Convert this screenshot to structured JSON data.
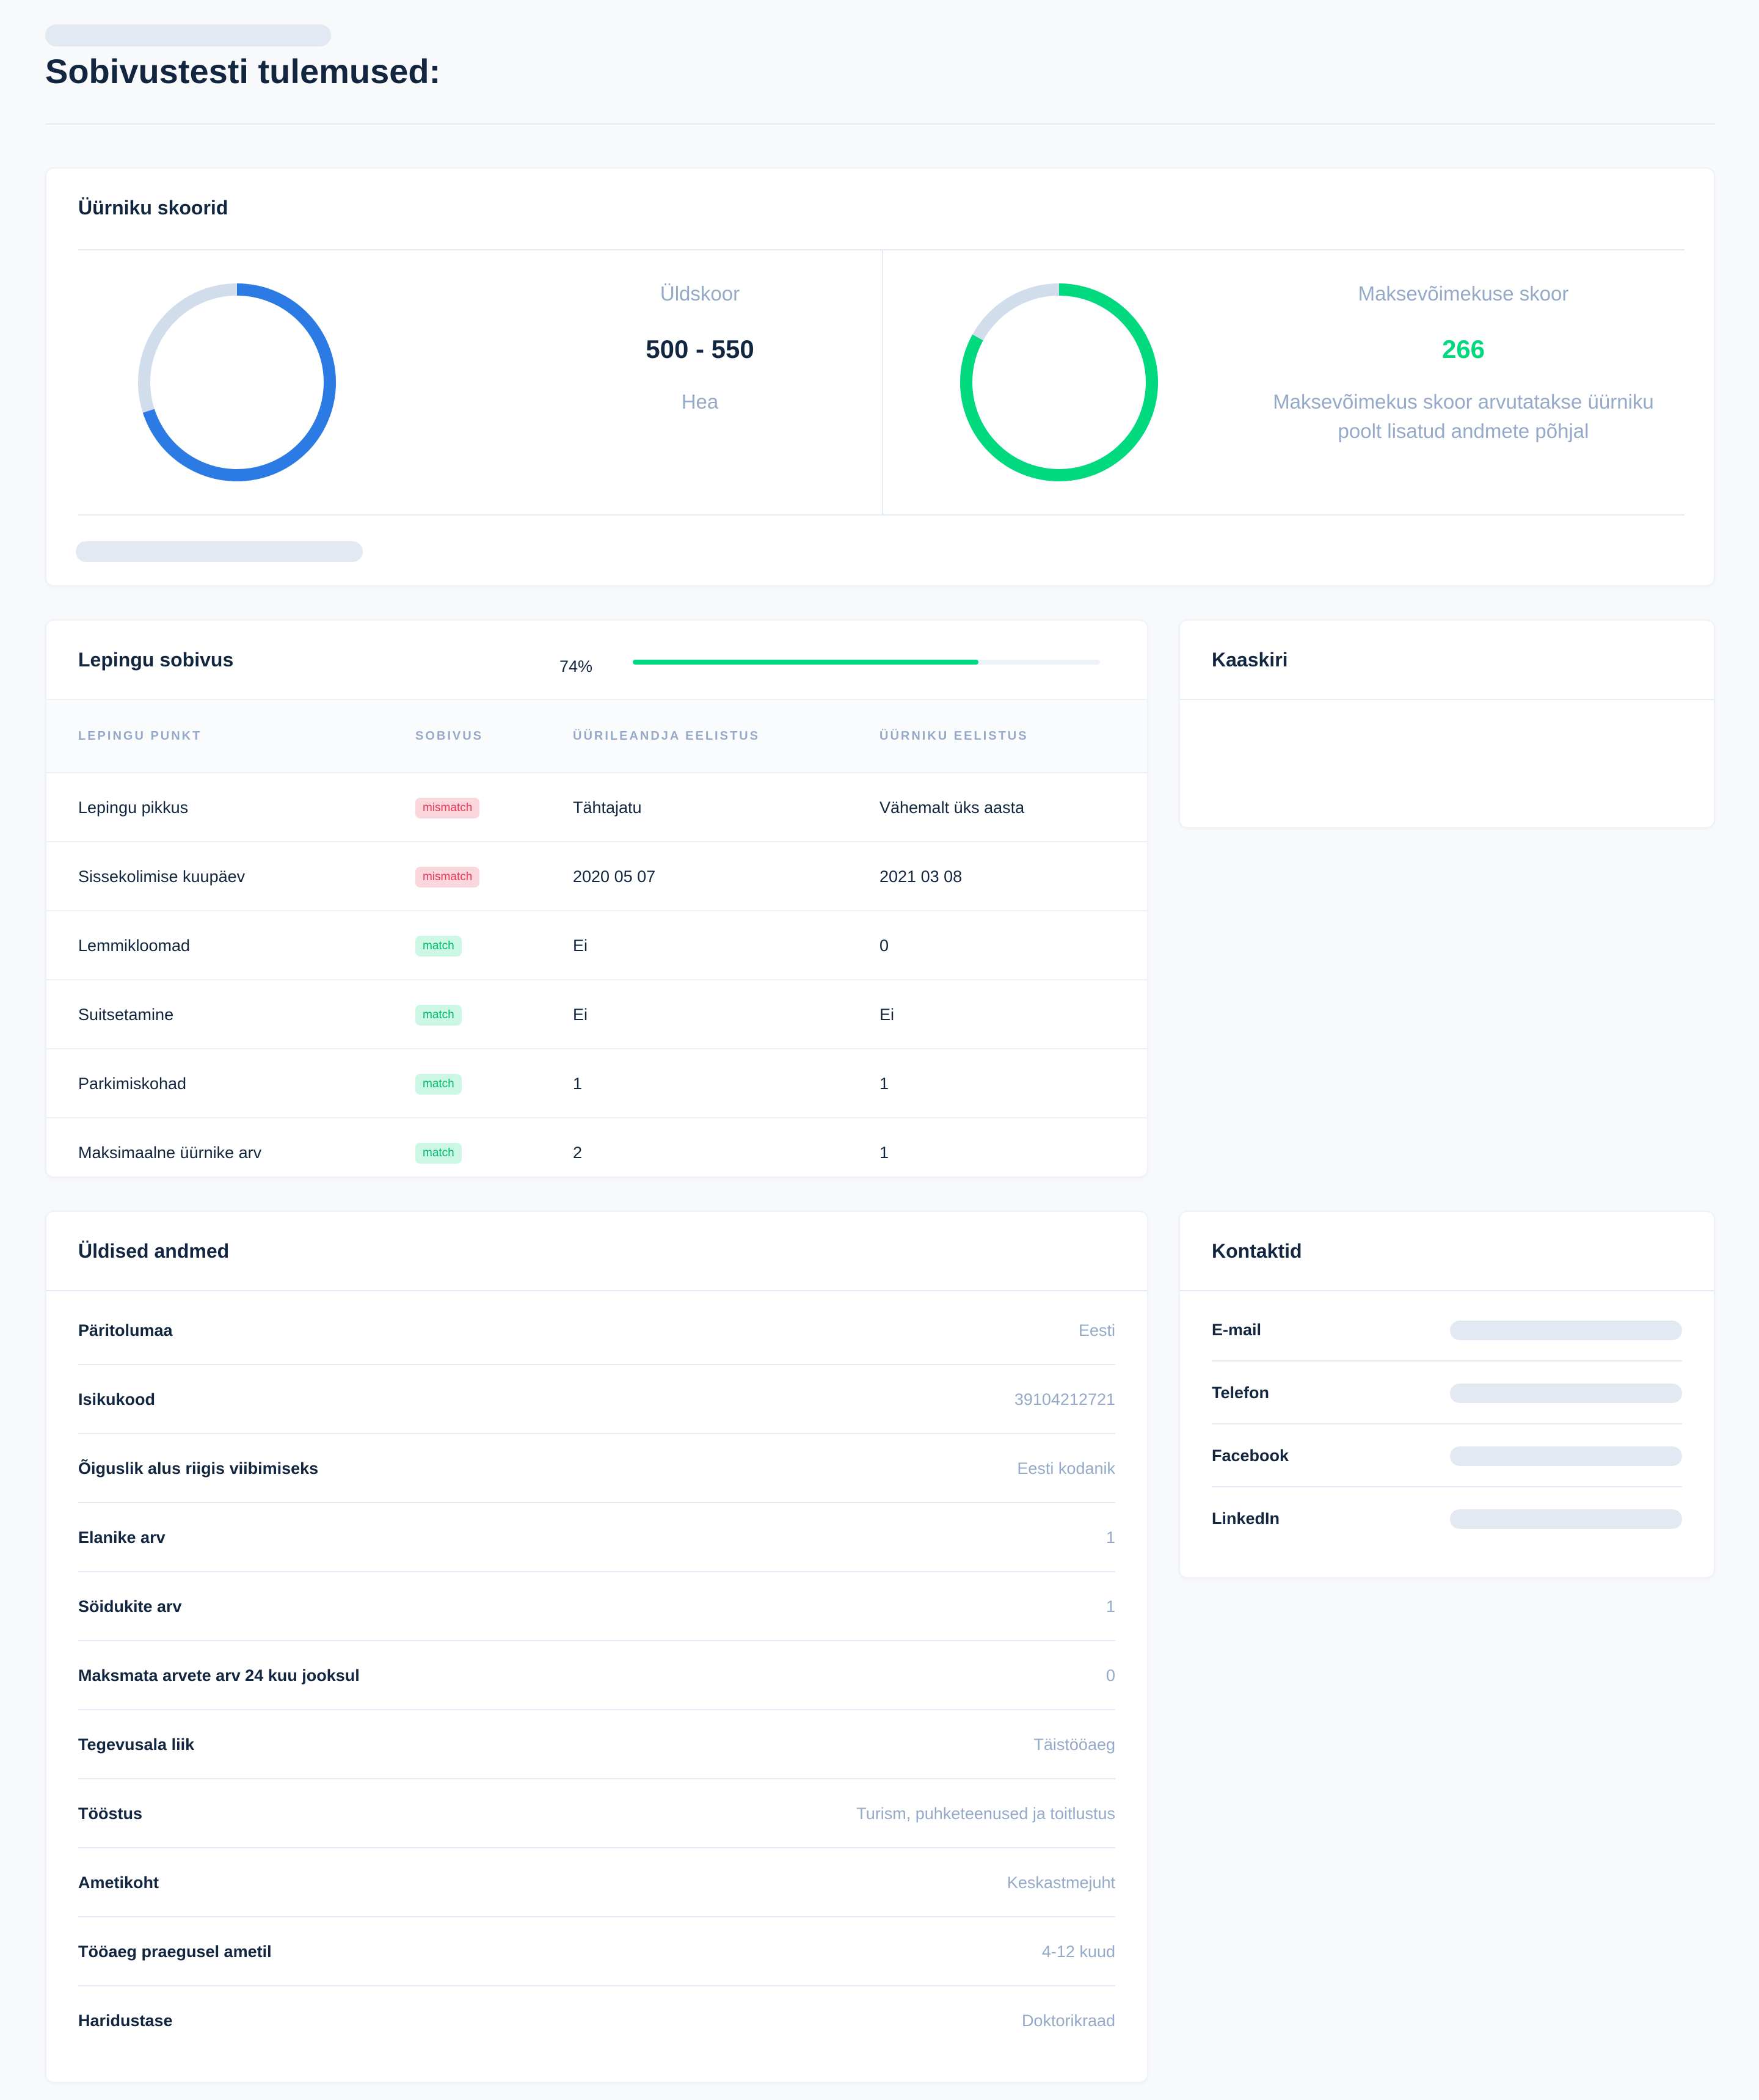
{
  "page": {
    "title": "Sobivustesti tulemused:"
  },
  "scores": {
    "title": "Üürniku skoorid",
    "overall": {
      "label": "Üldskoor",
      "value": "500 - 550",
      "rating": "Hea",
      "ring_fraction": 0.7,
      "color": "#2c7be5"
    },
    "solvency": {
      "label": "Maksevõimekuse skoor",
      "value": "266",
      "description": "Maksevõimekus skoor arvutatakse üürniku poolt lisatud andmete põhjal",
      "ring_fraction": 0.83,
      "color": "#00d97e"
    }
  },
  "contract": {
    "title": "Lepingu sobivus",
    "progress_label": "74%",
    "progress_value": 0.74,
    "headers": [
      "Lepingu punkt",
      "Sobivus",
      "Üürileandja eelistus",
      "Üürniku eelistus"
    ],
    "rows": [
      {
        "item": "Lepingu pikkus",
        "status": "mismatch",
        "landlord": "Tähtajatu",
        "tenant": "Vähemalt üks aasta"
      },
      {
        "item": "Sissekolimise kuupäev",
        "status": "mismatch",
        "landlord": "2020 05 07",
        "tenant": "2021 03 08"
      },
      {
        "item": "Lemmikloomad",
        "status": "match",
        "landlord": "Ei",
        "tenant": "0"
      },
      {
        "item": "Suitsetamine",
        "status": "match",
        "landlord": "Ei",
        "tenant": "Ei"
      },
      {
        "item": "Parkimiskohad",
        "status": "match",
        "landlord": "1",
        "tenant": "1"
      },
      {
        "item": "Maksimaalne üürnike arv",
        "status": "match",
        "landlord": "2",
        "tenant": "1"
      }
    ]
  },
  "cover_letter": {
    "title": "Kaaskiri"
  },
  "general": {
    "title": "Üldised andmed",
    "rows": [
      {
        "label": "Päritolumaa",
        "value": "Eesti"
      },
      {
        "label": "Isikukood",
        "value": "39104212721"
      },
      {
        "label": "Õiguslik alus riigis viibimiseks",
        "value": "Eesti kodanik"
      },
      {
        "label": "Elanike arv",
        "value": "1"
      },
      {
        "label": "Söidukite arv",
        "value": "1"
      },
      {
        "label": "Maksmata arvete arv 24 kuu jooksul",
        "value": "0"
      },
      {
        "label": "Tegevusala liik",
        "value": "Täistööaeg"
      },
      {
        "label": "Tööstus",
        "value": "Turism, puhketeenused ja toitlustus"
      },
      {
        "label": "Ametikoht",
        "value": "Keskastmejuht"
      },
      {
        "label": "Tööaeg praegusel ametil",
        "value": "4-12 kuud"
      },
      {
        "label": "Haridustase",
        "value": "Doktorikraad"
      }
    ]
  },
  "contacts": {
    "title": "Kontaktid",
    "rows": [
      {
        "label": "E-mail"
      },
      {
        "label": "Telefon"
      },
      {
        "label": "Facebook"
      },
      {
        "label": "LinkedIn"
      }
    ]
  }
}
